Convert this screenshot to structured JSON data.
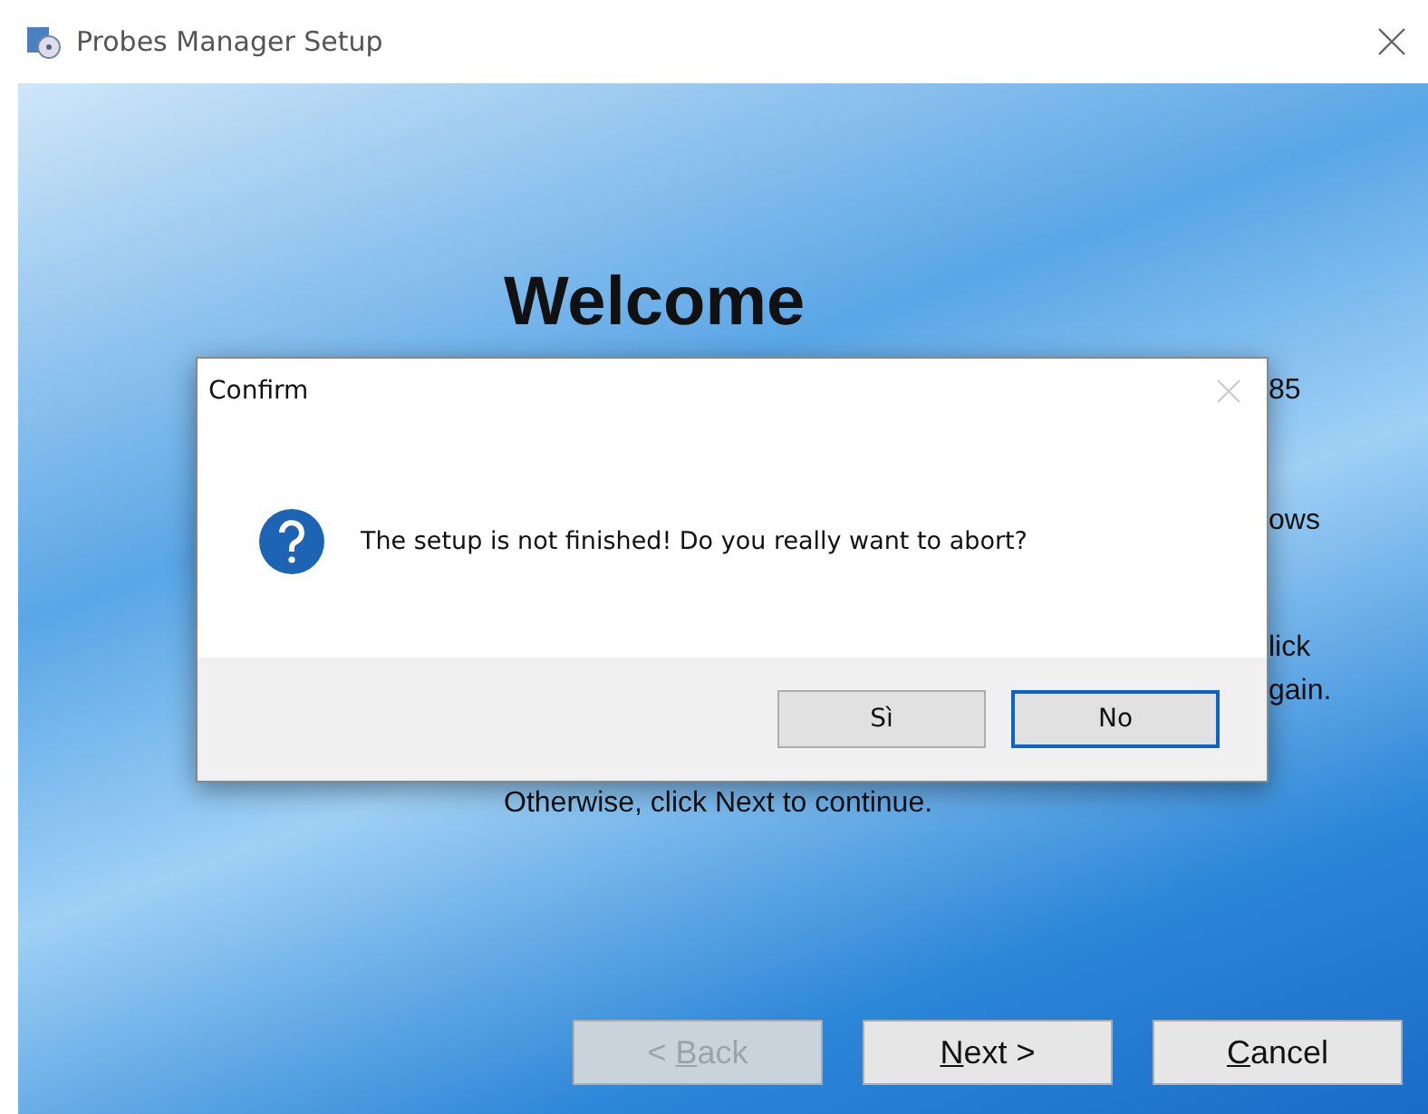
{
  "window": {
    "title": "Probes Manager Setup"
  },
  "wizard": {
    "heading": "Welcome",
    "visible_fragments": [
      "85",
      "ows",
      "lick",
      "gain."
    ],
    "footer_line": "Otherwise, click Next to continue."
  },
  "buttons": [
    {
      "before": "< ",
      "access_key": "B",
      "after": "ack",
      "disabled": true
    },
    {
      "access_key": "N",
      "after": "ext >",
      "disabled": false
    },
    {
      "access_key": "C",
      "after": "ancel",
      "disabled": false
    }
  ],
  "dialog": {
    "title": "Confirm",
    "message": "The setup is not finished! Do you really want to abort?",
    "buttons": [
      {
        "label": "Sì",
        "default": false
      },
      {
        "label": "No",
        "default": true
      }
    ]
  }
}
